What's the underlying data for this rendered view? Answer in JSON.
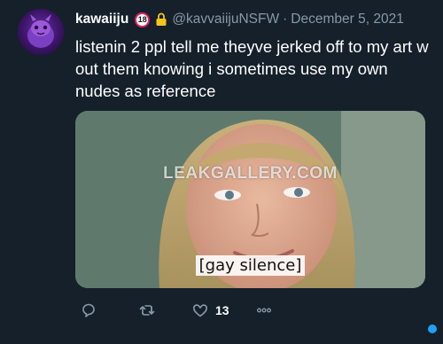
{
  "tweet": {
    "display_name": "kawaiiju",
    "age_badge": "18",
    "handle": "@kavvaiijuNSFW",
    "separator": "·",
    "date": "December 5, 2021",
    "text": "listenin 2 ppl tell me theyve jerked off to my art w out them knowing i sometimes use my own nudes as reference",
    "media": {
      "watermark": "LEAKGALLERY.COM",
      "caption": "[gay silence]"
    },
    "actions": {
      "reply_icon": "reply-icon",
      "retweet_icon": "retweet-icon",
      "like_icon": "heart-icon",
      "like_count": "13",
      "more_icon": "more-icon"
    }
  },
  "colors": {
    "background": "#15202b",
    "text": "#ffffff",
    "muted": "#8899a6",
    "accent": "#1da1f2",
    "badge_border": "#e0245e",
    "lock": "#f5c518"
  }
}
